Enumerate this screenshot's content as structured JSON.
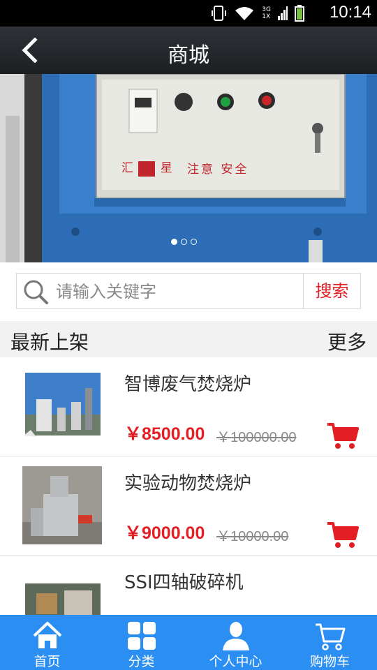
{
  "status_bar": {
    "time": "10:14",
    "network_top": "3G",
    "network_bottom": "1X"
  },
  "header": {
    "title": "商城"
  },
  "banner": {
    "panel_brand": "汇",
    "panel_brand2": "星",
    "panel_slogan": "注意 安全",
    "slides": 3,
    "active_slide": 1
  },
  "search": {
    "placeholder": "请输入关键字",
    "button_label": "搜索"
  },
  "section": {
    "title": "最新上架",
    "more_label": "更多"
  },
  "products": [
    {
      "name": "智博废气焚烧炉",
      "price": "￥8500.00",
      "old_price": "￥100000.00"
    },
    {
      "name": "实验动物焚烧炉",
      "price": "￥9000.00",
      "old_price": "￥10000.00"
    },
    {
      "name": "SSI四轴破碎机",
      "price": "",
      "old_price": ""
    }
  ],
  "tabbar": {
    "items": [
      {
        "label": "首页",
        "icon": "home-icon"
      },
      {
        "label": "分类",
        "icon": "grid-icon"
      },
      {
        "label": "个人中心",
        "icon": "person-icon"
      },
      {
        "label": "购物车",
        "icon": "cart-icon"
      }
    ]
  },
  "colors": {
    "accent_red": "#e31e24",
    "tabbar_blue": "#2a8ef2",
    "header_dark": "#25292d"
  }
}
